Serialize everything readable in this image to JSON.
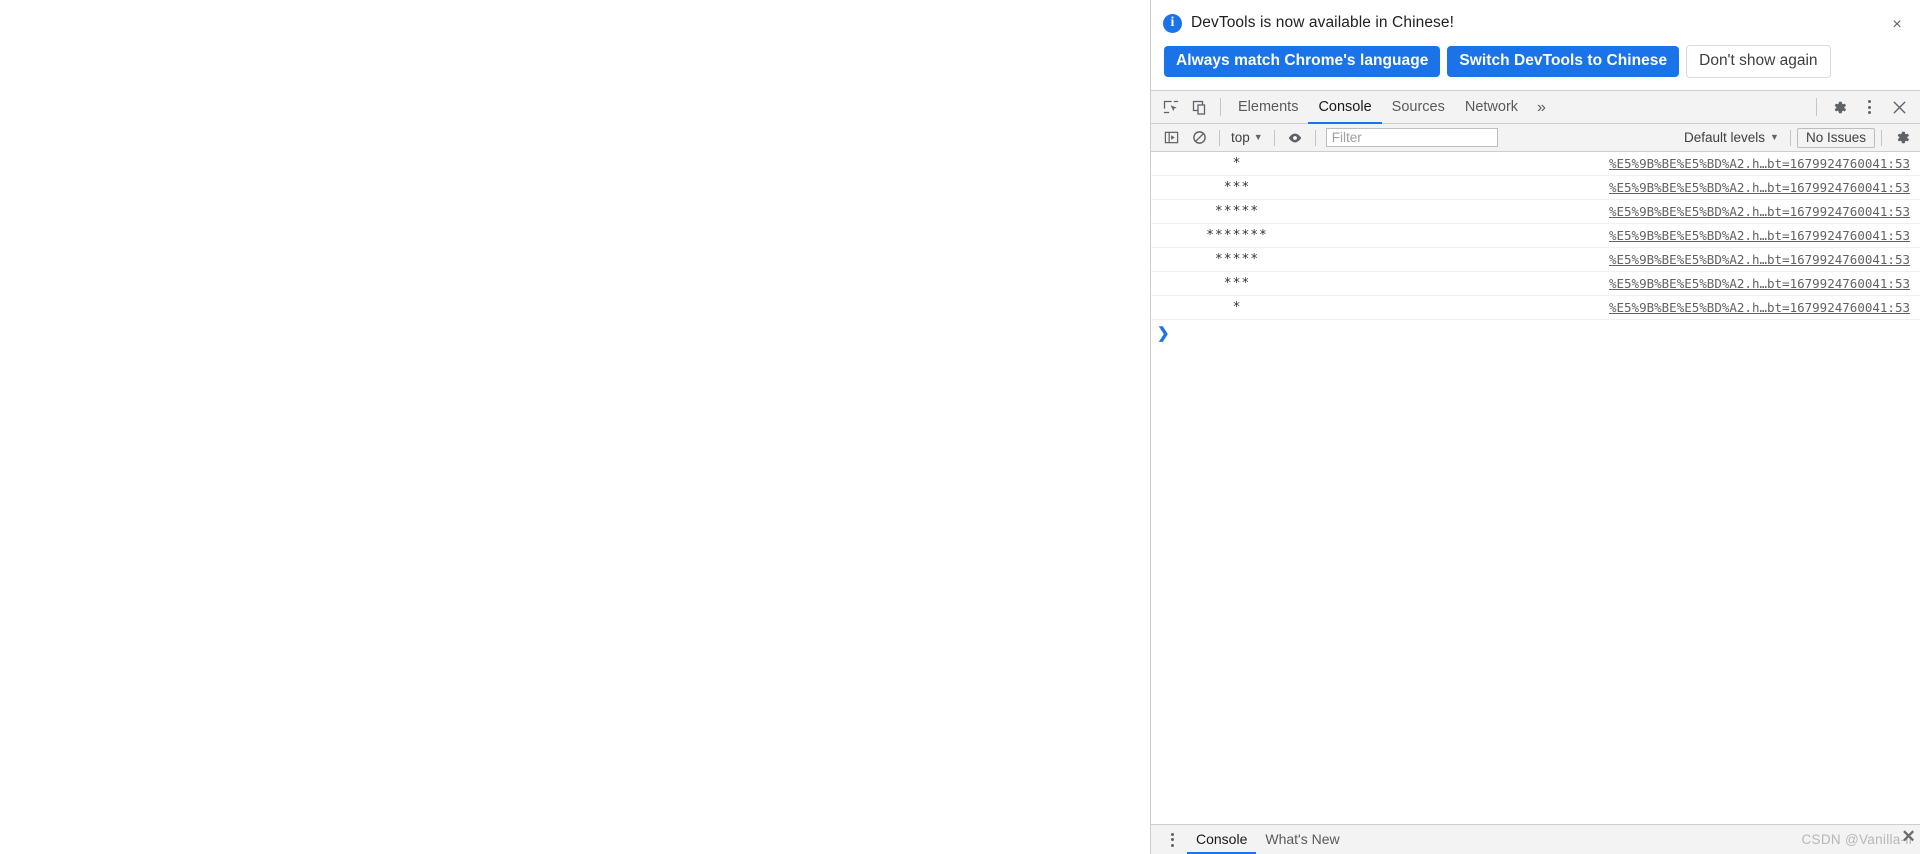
{
  "banner": {
    "icon": "info-circle-icon",
    "message": "DevTools is now available in Chinese!",
    "primary_button_1": "Always match Chrome's language",
    "primary_button_2": "Switch DevTools to Chinese",
    "secondary_button": "Don't show again",
    "close_icon": "×",
    "accent_color": "#1a73e8"
  },
  "tabbar": {
    "inspect_icon": "cursor-select-icon",
    "device_icon": "device-toolbar-icon",
    "tabs": [
      {
        "label": "Elements",
        "selected": false
      },
      {
        "label": "Console",
        "selected": true
      },
      {
        "label": "Sources",
        "selected": false
      },
      {
        "label": "Network",
        "selected": false
      }
    ],
    "more_tabs_icon": "»",
    "settings_icon": "gear-icon",
    "menu_icon": "three-dots-vertical-icon",
    "close_icon": "close-x-icon"
  },
  "console_toolbar": {
    "sidebar_toggle_icon": "console-sidebar-icon",
    "clear_icon": "clear-console-icon",
    "context_label": "top",
    "context_caret": "▼",
    "live_expression_icon": "eye-icon",
    "filter_placeholder": "Filter",
    "filter_value": "",
    "levels_label": "Default levels",
    "levels_caret": "▼",
    "issues_label": "No Issues",
    "settings_icon": "gear-icon"
  },
  "console_log": {
    "source_link": "%E5%9B%BE%E5%BD%A2.h…bt=1679924760041:53",
    "rows": [
      {
        "message": "*"
      },
      {
        "message": "***"
      },
      {
        "message": "*****"
      },
      {
        "message": "*******"
      },
      {
        "message": "*****"
      },
      {
        "message": "***"
      },
      {
        "message": "*"
      }
    ],
    "prompt_chevron": "❯",
    "prompt_value": ""
  },
  "drawer": {
    "menu_icon": "three-dots-vertical-icon",
    "tabs": [
      {
        "label": "Console",
        "selected": true
      },
      {
        "label": "What's New",
        "selected": false
      }
    ],
    "watermark": "CSDN @Vanilla-li",
    "watermark_close_icon": "✕"
  }
}
